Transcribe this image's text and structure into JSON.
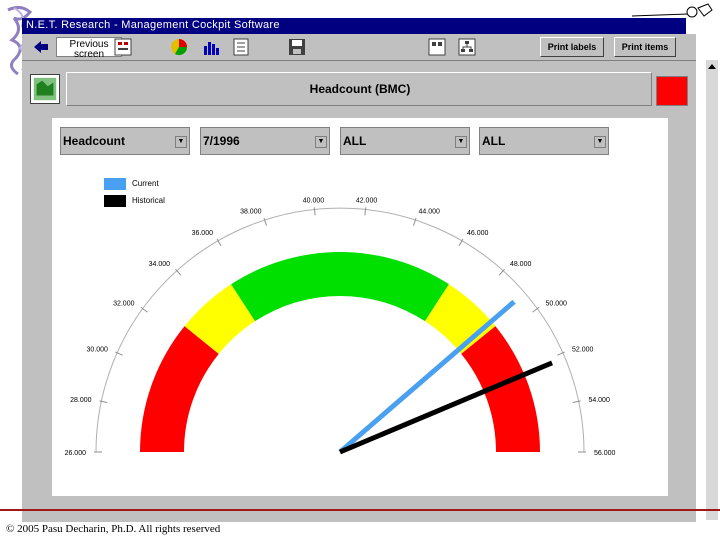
{
  "window": {
    "title": "N.E.T. Research - Management Cockpit Software"
  },
  "toolbar": {
    "previous_label": "Previous screen",
    "print_labels": "Print labels",
    "print_items": "Print items"
  },
  "header": {
    "title": "Headcount (BMC)"
  },
  "filters": [
    {
      "value": "Headcount"
    },
    {
      "value": "7/1996"
    },
    {
      "value": "ALL"
    },
    {
      "value": "ALL"
    }
  ],
  "legend": {
    "current": "Current",
    "historical": "Historical"
  },
  "colors": {
    "current": "#4aa0f0",
    "historical": "#000000",
    "red": "#ff0000",
    "yellow": "#ffff00",
    "green": "#00e000"
  },
  "chart_data": {
    "type": "gauge",
    "scale_min": 26000,
    "scale_max": 56000,
    "tick_labels": [
      "26.000",
      "28.000",
      "30.000",
      "32.000",
      "34.000",
      "36.000",
      "38.000",
      "40.000",
      "42.000",
      "44.000",
      "46.000",
      "48.000",
      "50.000",
      "52.000",
      "54.000",
      "56.000"
    ],
    "bands": [
      {
        "from": 26000,
        "to": 32500,
        "color": "red"
      },
      {
        "from": 32500,
        "to": 35500,
        "color": "yellow"
      },
      {
        "from": 35500,
        "to": 46500,
        "color": "green"
      },
      {
        "from": 46500,
        "to": 49500,
        "color": "yellow"
      },
      {
        "from": 49500,
        "to": 56000,
        "color": "red"
      }
    ],
    "series": [
      {
        "name": "Current",
        "value": 49200
      },
      {
        "name": "Historical",
        "value": 52200
      }
    ]
  },
  "footer": {
    "copyright": "© 2005 Pasu Decharin, Ph.D. All rights reserved"
  }
}
